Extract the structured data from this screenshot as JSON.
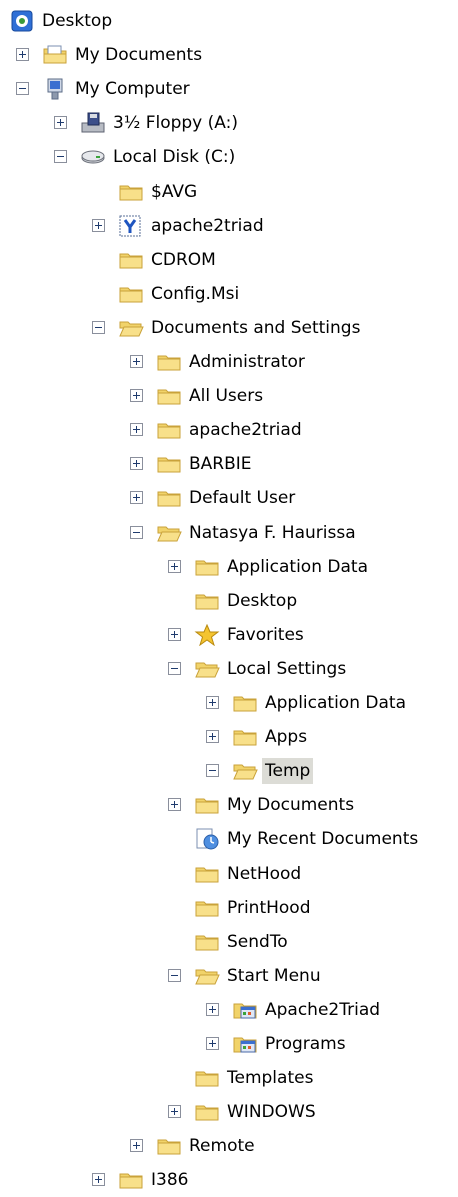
{
  "tree": [
    {
      "id": "desktop",
      "label": "Desktop",
      "level": 0,
      "icon": "desktop-icon",
      "expander": "none"
    },
    {
      "id": "my-documents",
      "label": "My Documents",
      "level": 1,
      "icon": "my-documents-icon",
      "expander": "plus"
    },
    {
      "id": "my-computer",
      "label": "My Computer",
      "level": 1,
      "icon": "my-computer-icon",
      "expander": "minus"
    },
    {
      "id": "floppy",
      "label": "3½ Floppy (A:)",
      "level": 2,
      "icon": "floppy-drive-icon",
      "expander": "plus"
    },
    {
      "id": "local-disk",
      "label": "Local Disk (C:)",
      "level": 2,
      "icon": "hard-drive-icon",
      "expander": "minus"
    },
    {
      "id": "avg",
      "label": "$AVG",
      "level": 3,
      "icon": "folder-icon",
      "expander": "none"
    },
    {
      "id": "apache2triad-root",
      "label": "apache2triad",
      "level": 3,
      "icon": "apache-folder-icon",
      "expander": "plus"
    },
    {
      "id": "cdrom",
      "label": "CDROM",
      "level": 3,
      "icon": "folder-icon",
      "expander": "none"
    },
    {
      "id": "config-msi",
      "label": "Config.Msi",
      "level": 3,
      "icon": "folder-icon",
      "expander": "none"
    },
    {
      "id": "docs-settings",
      "label": "Documents and Settings",
      "level": 3,
      "icon": "folder-open-icon",
      "expander": "minus"
    },
    {
      "id": "administrator",
      "label": "Administrator",
      "level": 4,
      "icon": "folder-icon",
      "expander": "plus"
    },
    {
      "id": "all-users",
      "label": "All Users",
      "level": 4,
      "icon": "folder-icon",
      "expander": "plus"
    },
    {
      "id": "apache2triad-user",
      "label": "apache2triad",
      "level": 4,
      "icon": "folder-icon",
      "expander": "plus"
    },
    {
      "id": "barbie",
      "label": "BARBIE",
      "level": 4,
      "icon": "folder-icon",
      "expander": "plus"
    },
    {
      "id": "default-user",
      "label": "Default User",
      "level": 4,
      "icon": "folder-icon",
      "expander": "plus"
    },
    {
      "id": "natasya",
      "label": "Natasya F. Haurissa",
      "level": 4,
      "icon": "folder-open-icon",
      "expander": "minus"
    },
    {
      "id": "app-data",
      "label": "Application Data",
      "level": 5,
      "icon": "folder-icon",
      "expander": "plus"
    },
    {
      "id": "desktop-folder",
      "label": "Desktop",
      "level": 5,
      "icon": "folder-icon",
      "expander": "none"
    },
    {
      "id": "favorites",
      "label": "Favorites",
      "level": 5,
      "icon": "favorites-star-icon",
      "expander": "plus"
    },
    {
      "id": "local-settings",
      "label": "Local Settings",
      "level": 5,
      "icon": "folder-open-icon",
      "expander": "minus"
    },
    {
      "id": "ls-app-data",
      "label": "Application Data",
      "level": 6,
      "icon": "folder-icon",
      "expander": "plus"
    },
    {
      "id": "apps",
      "label": "Apps",
      "level": 6,
      "icon": "folder-icon",
      "expander": "plus"
    },
    {
      "id": "temp",
      "label": "Temp",
      "level": 6,
      "icon": "folder-open-icon",
      "expander": "minus",
      "selected": true
    },
    {
      "id": "user-my-docs",
      "label": "My Documents",
      "level": 5,
      "icon": "folder-icon",
      "expander": "plus"
    },
    {
      "id": "recent-docs",
      "label": "My Recent Documents",
      "level": 5,
      "icon": "recent-documents-icon",
      "expander": "none"
    },
    {
      "id": "nethood",
      "label": "NetHood",
      "level": 5,
      "icon": "folder-icon",
      "expander": "none"
    },
    {
      "id": "printhood",
      "label": "PrintHood",
      "level": 5,
      "icon": "folder-icon",
      "expander": "none"
    },
    {
      "id": "sendto",
      "label": "SendTo",
      "level": 5,
      "icon": "folder-icon",
      "expander": "none"
    },
    {
      "id": "start-menu",
      "label": "Start Menu",
      "level": 5,
      "icon": "folder-open-icon",
      "expander": "minus"
    },
    {
      "id": "sm-apache",
      "label": "Apache2Triad",
      "level": 6,
      "icon": "program-group-icon",
      "expander": "plus"
    },
    {
      "id": "sm-programs",
      "label": "Programs",
      "level": 6,
      "icon": "program-group-icon",
      "expander": "plus"
    },
    {
      "id": "templates",
      "label": "Templates",
      "level": 5,
      "icon": "folder-icon",
      "expander": "none"
    },
    {
      "id": "windows-user",
      "label": "WINDOWS",
      "level": 5,
      "icon": "folder-icon",
      "expander": "plus"
    },
    {
      "id": "remote",
      "label": "Remote",
      "level": 4,
      "icon": "folder-icon",
      "expander": "plus"
    },
    {
      "id": "i386",
      "label": "I386",
      "level": 3,
      "icon": "folder-icon",
      "expander": "plus"
    }
  ],
  "colors": {
    "folder": "#f1d36a",
    "folder_dark": "#c9a23a",
    "selection": "#dcdcd6",
    "expander_border": "#8a8f9c"
  }
}
